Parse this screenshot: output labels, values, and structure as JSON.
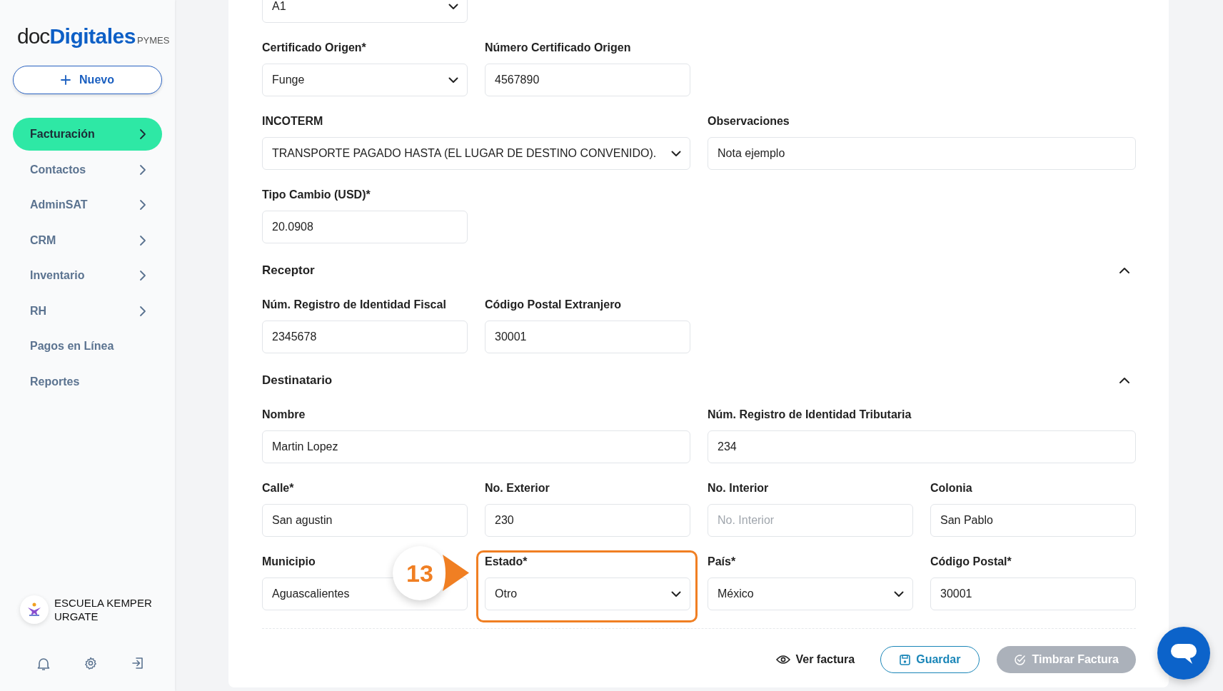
{
  "sidebar": {
    "logo": {
      "part_a": "doc",
      "part_b": "Digitales",
      "suffix": "PYMES"
    },
    "new_button": {
      "label": "Nuevo"
    },
    "menu": [
      {
        "label": "Facturación",
        "selected": true,
        "has_submenu": true
      },
      {
        "label": "Contactos",
        "selected": false,
        "has_submenu": true
      },
      {
        "label": "AdminSAT",
        "selected": false,
        "has_submenu": true
      },
      {
        "label": "CRM",
        "selected": false,
        "has_submenu": true
      },
      {
        "label": "Inventario",
        "selected": false,
        "has_submenu": true
      },
      {
        "label": "RH",
        "selected": false,
        "has_submenu": true
      },
      {
        "label": "Pagos en Línea",
        "selected": false,
        "has_submenu": false
      },
      {
        "label": "Reportes",
        "selected": false,
        "has_submenu": false
      }
    ],
    "organization": {
      "name_lines": [
        "ESCUELA KEMPER",
        "URGATE"
      ]
    }
  },
  "form": [
    {
      "kind": "row",
      "fields": [
        {
          "kind": "select",
          "value": "A1",
          "wide": false
        }
      ]
    },
    {
      "kind": "row",
      "fields": [
        {
          "kind": "select",
          "label": "Certificado Origen*",
          "value": "Funge",
          "wide": false
        },
        {
          "kind": "input",
          "label": "Número Certificado Origen",
          "value": "4567890",
          "wide": false
        }
      ]
    },
    {
      "kind": "row",
      "fields": [
        {
          "kind": "select",
          "label": "INCOTERM",
          "value": "TRANSPORTE PAGADO HASTA (EL LUGAR DE DESTINO CONVENIDO).",
          "wide": true
        },
        {
          "kind": "input",
          "label": "Observaciones",
          "value": "Nota ejemplo",
          "wide": true
        }
      ]
    },
    {
      "kind": "row",
      "fields": [
        {
          "kind": "input",
          "label": "Tipo Cambio (USD)*",
          "value": "20.0908",
          "wide": false
        }
      ]
    },
    {
      "kind": "section",
      "title": "Receptor",
      "expanded": true
    },
    {
      "kind": "row",
      "fields": [
        {
          "kind": "input",
          "label": "Núm. Registro de Identidad Fiscal",
          "value": "2345678",
          "wide": false
        },
        {
          "kind": "input",
          "label": "Código Postal Extranjero",
          "value": "30001",
          "wide": false
        }
      ]
    },
    {
      "kind": "section",
      "title": "Destinatario",
      "expanded": true
    },
    {
      "kind": "row",
      "fields": [
        {
          "kind": "input",
          "label": "Nombre",
          "value": "Martin Lopez",
          "wide": true
        },
        {
          "kind": "input",
          "label": "Núm. Registro de Identidad Tributaria",
          "value": "234",
          "wide": true
        }
      ]
    },
    {
      "kind": "row",
      "fields": [
        {
          "kind": "input",
          "label": "Calle*",
          "value": "San agustin",
          "wide": false
        },
        {
          "kind": "input",
          "label": "No. Exterior",
          "value": "230",
          "wide": false
        },
        {
          "kind": "input",
          "label": "No. Interior",
          "placeholder": "No. Interior",
          "wide": false
        },
        {
          "kind": "input",
          "label": "Colonia",
          "value": "San Pablo",
          "wide": false
        }
      ]
    },
    {
      "kind": "row",
      "fields": [
        {
          "kind": "input",
          "label": "Municipio",
          "value": "Aguascalientes",
          "wide": false
        },
        {
          "kind": "select",
          "label": "Estado*",
          "value": "Otro",
          "wide": false,
          "callout": "13"
        },
        {
          "kind": "select",
          "label": "País*",
          "value": "México",
          "wide": false
        },
        {
          "kind": "input",
          "label": "Código Postal*",
          "value": "30001",
          "wide": false
        }
      ]
    }
  ],
  "actions": [
    {
      "kind": "link",
      "label": "Ver factura",
      "disabled": false
    },
    {
      "kind": "outline",
      "label": "Guardar",
      "disabled": false
    },
    {
      "kind": "primary",
      "label": "Timbrar Factura",
      "disabled": true
    }
  ]
}
